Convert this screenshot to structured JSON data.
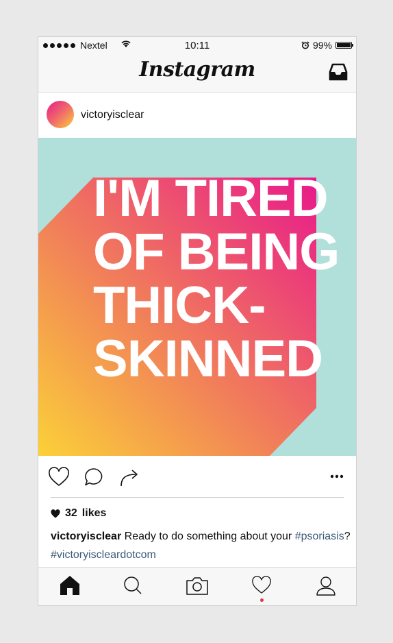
{
  "status_bar": {
    "carrier": "Nextel",
    "time": "10:11",
    "battery": "99%",
    "battery_level": 0.99,
    "icons": [
      "signal-dots-icon",
      "wifi-icon",
      "alarm-icon",
      "battery-icon"
    ]
  },
  "nav": {
    "logo": "Instagram",
    "inbox_icon": "inbox-icon"
  },
  "post": {
    "username": "victoryisclear",
    "image_text": [
      "I'M TIRED",
      "OF BEING",
      "THICK-",
      "SKINNED"
    ],
    "image_colors": {
      "background": "#b1dfda",
      "gradient_start": "#fbd138",
      "gradient_mid": "#f17e5a",
      "gradient_end": "#e8198b",
      "text": "#ffffff"
    },
    "actions": [
      "heart-icon",
      "comment-icon",
      "share-icon",
      "more-icon"
    ],
    "likes_count": "32",
    "likes_label": "likes",
    "caption_user": "victoryisclear",
    "caption_text": " Ready to do something about your ",
    "hashtag_1": "#psoriasis",
    "caption_after": "?",
    "hashtag_2": "#victoryiscleardotcom",
    "hashtag_color": "#3c5a7a"
  },
  "tab_bar": {
    "items": [
      "home-icon",
      "search-icon",
      "camera-icon",
      "activity-heart-icon",
      "profile-icon"
    ],
    "active": "home-icon",
    "notification_color": "#e8334a"
  }
}
